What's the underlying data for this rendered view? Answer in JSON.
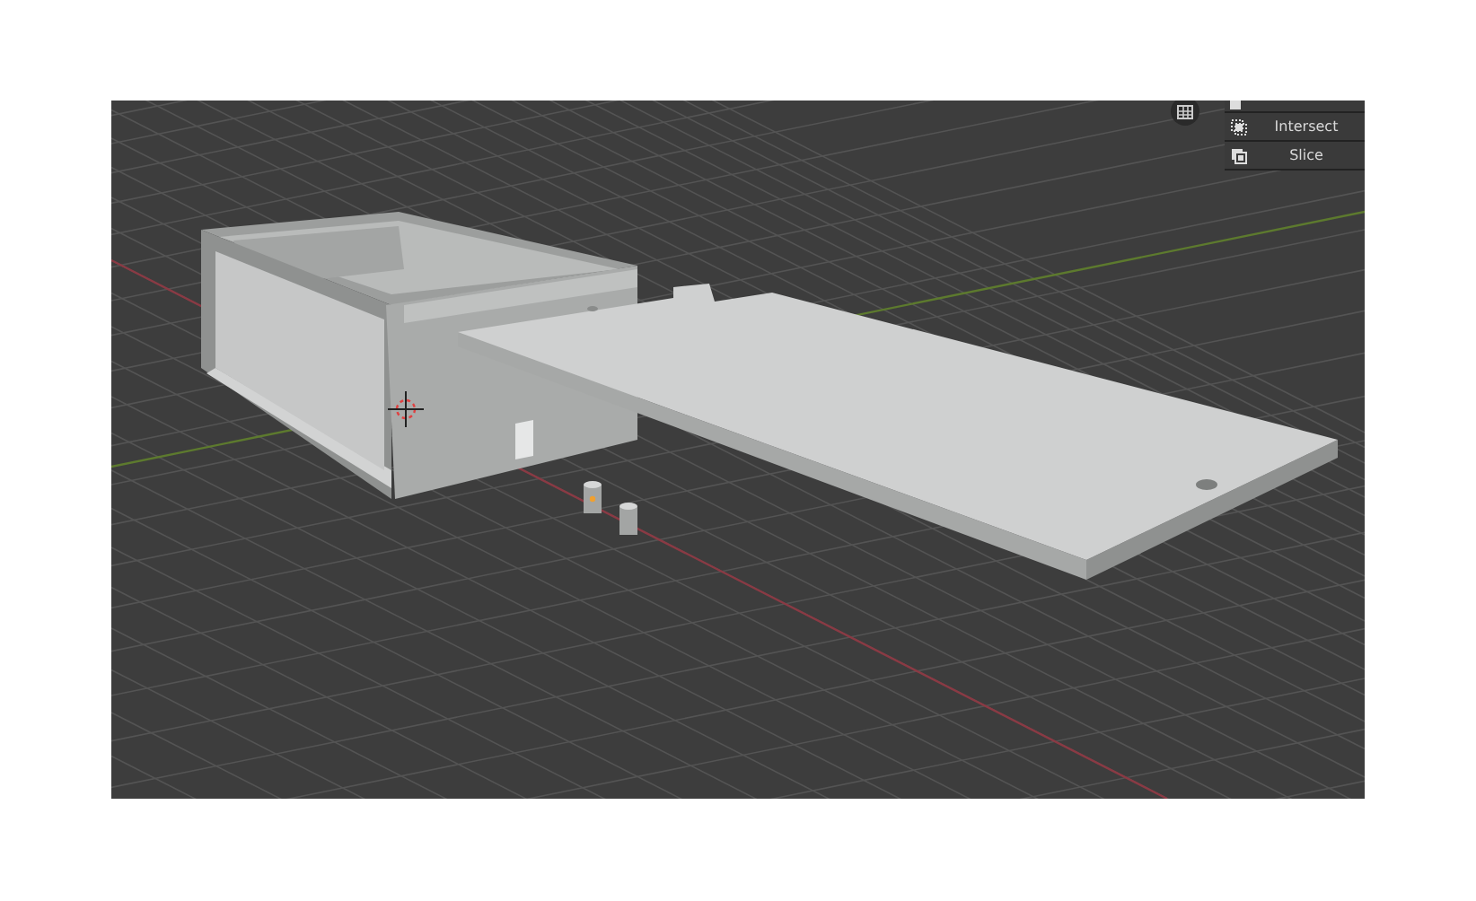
{
  "viewport": {
    "boolean_menu": {
      "items": [
        {
          "kind": "intersect",
          "label": "Intersect"
        },
        {
          "kind": "slice",
          "label": "Slice"
        }
      ]
    }
  }
}
